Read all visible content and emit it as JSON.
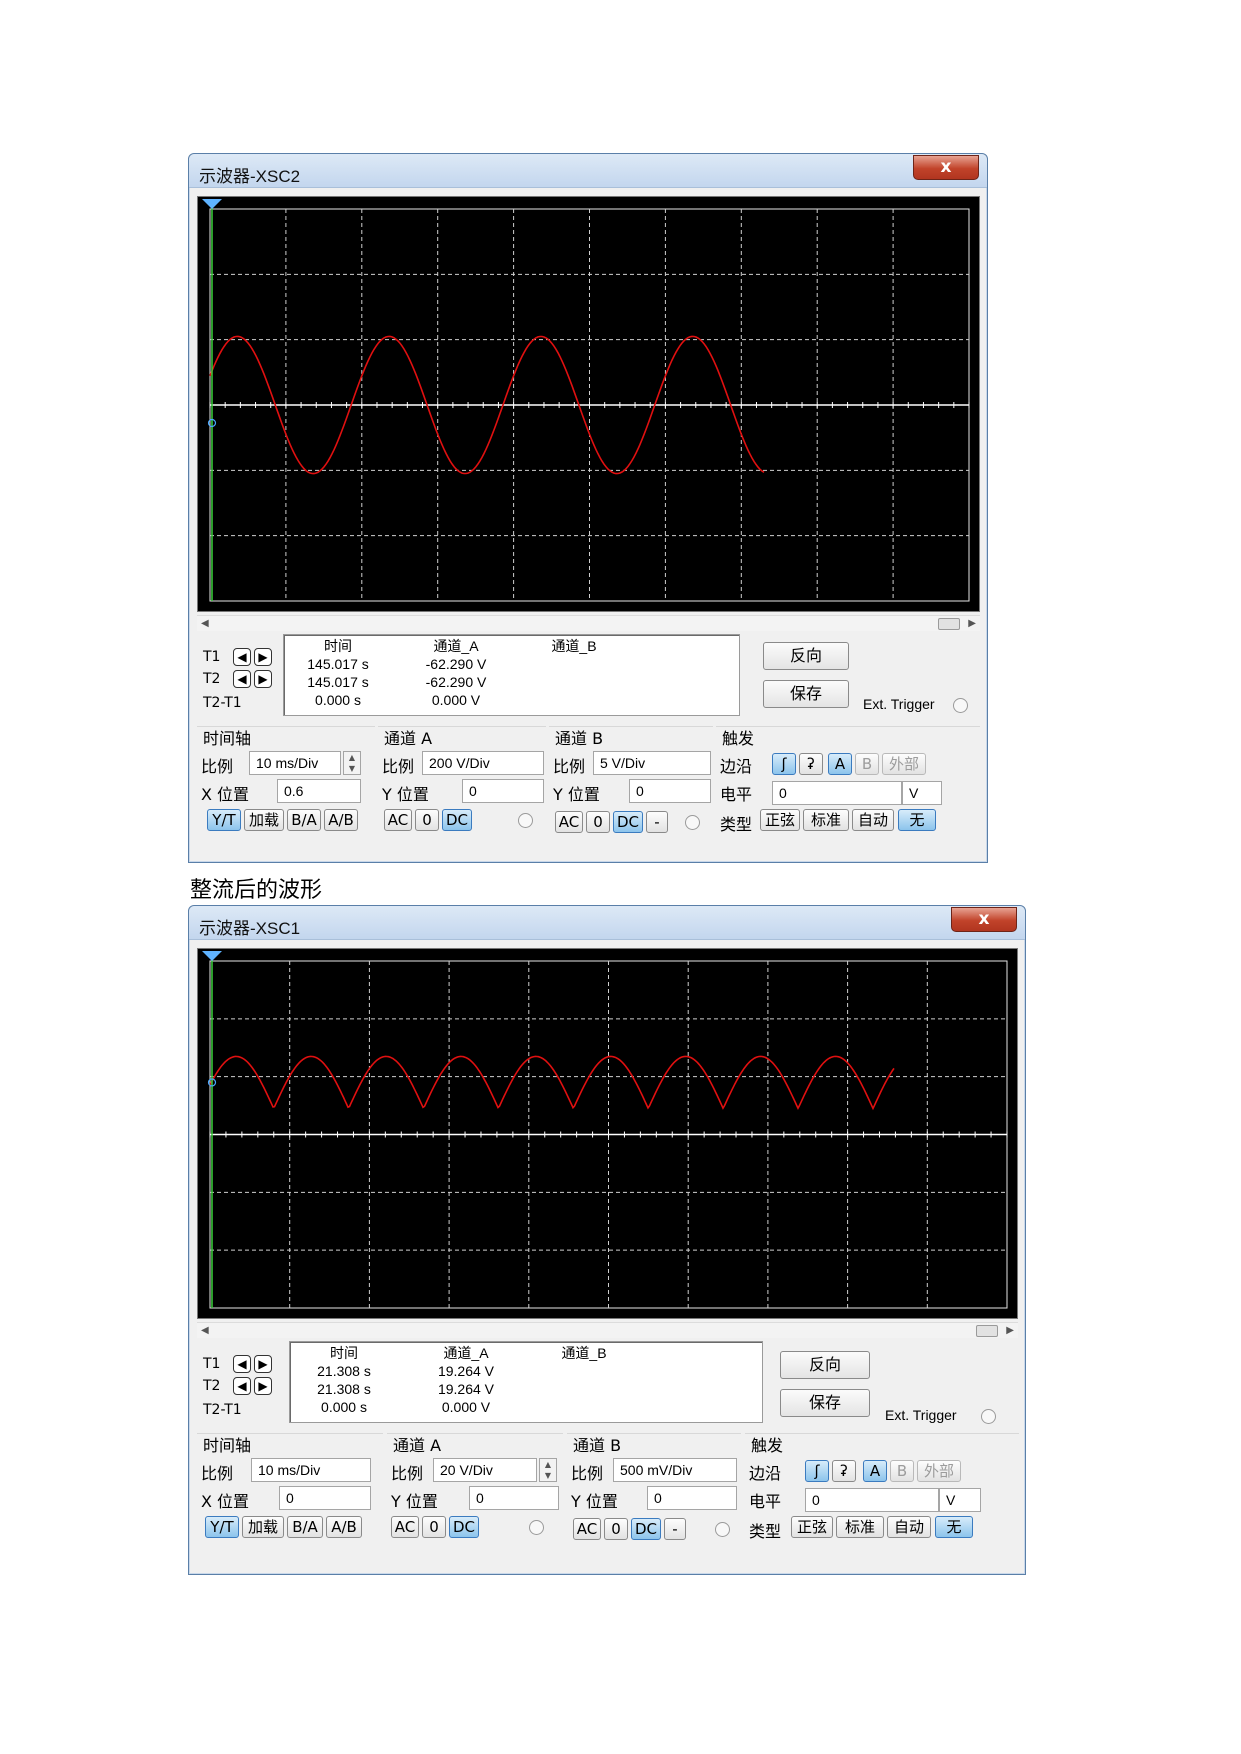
{
  "caption": "整流后的波形",
  "common": {
    "close_glyph": "x",
    "t1": "T1",
    "t2": "T2",
    "t2t1": "T2-T1",
    "arrow_left": "🡄",
    "arrow_right": "🡆",
    "col_time": "时间",
    "col_cha": "通道_A",
    "col_chb": "通道_B",
    "reverse": "反向",
    "save": "保存",
    "ext_trigger": "Ext. Trigger",
    "timebase_title": "时间轴",
    "cha_title": "通道 A",
    "chb_title": "通道 B",
    "trigger_title": "触发",
    "scale": "比例",
    "xpos": "X 位置",
    "ypos": "Y 位置",
    "edge": "边沿",
    "level": "电平",
    "type": "类型",
    "yt": "Y/T",
    "add": "加载",
    "ba": "B/A",
    "ab": "A/B",
    "ac": "AC",
    "zero": "0",
    "dc": "DC",
    "minus": "-",
    "edge_rise": "ʃ",
    "edge_fall": "ʡ",
    "src_a": "A",
    "src_b": "B",
    "src_ext": "外部",
    "unit_v": "V",
    "type_sine": "正弦",
    "type_std": "标准",
    "type_auto": "自动",
    "type_none": "无"
  },
  "scope1": {
    "title": "示波器-XSC2",
    "readout": {
      "t1": {
        "time": "145.017 s",
        "cha": "-62.290 V",
        "chb": ""
      },
      "t2": {
        "time": "145.017 s",
        "cha": "-62.290 V",
        "chb": ""
      },
      "diff": {
        "time": "0.000 s",
        "cha": "0.000 V",
        "chb": ""
      }
    },
    "timebase": {
      "scale": "10 ms/Div",
      "xpos": "0.6"
    },
    "cha": {
      "scale": "200  V/Div",
      "ypos": "0"
    },
    "chb": {
      "scale": "5  V/Div",
      "ypos": "0"
    },
    "trigger": {
      "level": "0"
    },
    "waveform": {
      "shape": "sine",
      "color": "#e01010",
      "amplitude_div": 1.0,
      "cycles": 5,
      "offset_div": 0
    }
  },
  "scope2": {
    "title": "示波器-XSC1",
    "readout": {
      "t1": {
        "time": "21.308 s",
        "cha": "19.264 V",
        "chb": ""
      },
      "t2": {
        "time": "21.308 s",
        "cha": "19.264 V",
        "chb": ""
      },
      "diff": {
        "time": "0.000 s",
        "cha": "0.000 V",
        "chb": ""
      }
    },
    "timebase": {
      "scale": "10 ms/Div",
      "xpos": "0"
    },
    "cha": {
      "scale": "20  V/Div",
      "ypos": "0"
    },
    "chb": {
      "scale": "500 mV/Div",
      "ypos": "0"
    },
    "trigger": {
      "level": "0"
    },
    "waveform": {
      "shape": "rectified",
      "color": "#e01010",
      "cycles": 10
    }
  },
  "colors": {
    "grid": "#cfcfcf",
    "cursor": "#3ad13a",
    "trace": "#e01010",
    "baseline": "#ffffff"
  }
}
